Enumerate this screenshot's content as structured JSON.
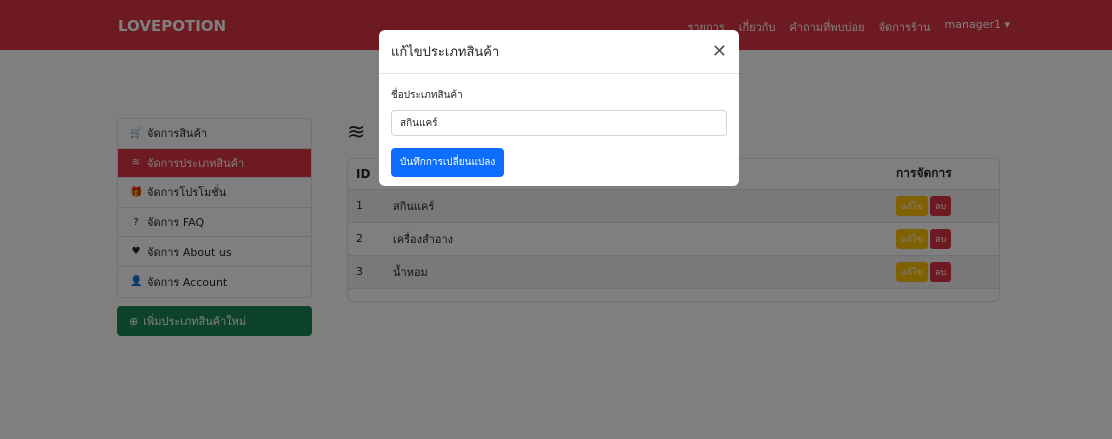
{
  "brand": "LOVEPOTION",
  "nav": {
    "links": [
      "รายการ",
      "เกี่ยวกับ",
      "คำถามที่พบบ่อย",
      "จัดการร้าน",
      "manager1 ▾"
    ]
  },
  "sidebar": {
    "items": [
      {
        "label": "จัดการสินค้า",
        "icon": "cart-icon",
        "glyph": "🛒"
      },
      {
        "label": "จัดการประเภทสินค้า",
        "icon": "layers-icon",
        "glyph": "≋"
      },
      {
        "label": "จัดการโปรโมชั่น",
        "icon": "gift-icon",
        "glyph": "🎁"
      },
      {
        "label": "จัดการ FAQ",
        "icon": "question-circle-icon",
        "glyph": "?"
      },
      {
        "label": "จัดการ About us",
        "icon": "heart-icon",
        "glyph": "♥"
      },
      {
        "label": "จัดการ Account",
        "icon": "user-icon",
        "glyph": "👤"
      }
    ],
    "add_button": "เพิ่มประเภทสินค้าใหม่"
  },
  "table": {
    "headers": {
      "id": "ID",
      "name": "",
      "actions": "การจัดการ"
    },
    "rows": [
      {
        "id": "1",
        "name": "สกินแคร์"
      },
      {
        "id": "2",
        "name": "เครื่องสำอาง"
      },
      {
        "id": "3",
        "name": "น้ำหอม"
      }
    ],
    "edit_label": "แก้ไข",
    "delete_label": "ลบ"
  },
  "modal": {
    "title": "แก้ไขประเภทสินค้า",
    "field_label": "ชื่อประเภทสินค้า",
    "field_value": "สกินแคร์",
    "save_label": "บันทึกการเปลี่ยนแปลง"
  },
  "colors": {
    "navbar": "#dc3545",
    "sidebar_active": "#dc3545",
    "add_button": "#198754",
    "edit_button": "#ffc107",
    "delete_button": "#dc3545",
    "save_button": "#0d6efd"
  }
}
